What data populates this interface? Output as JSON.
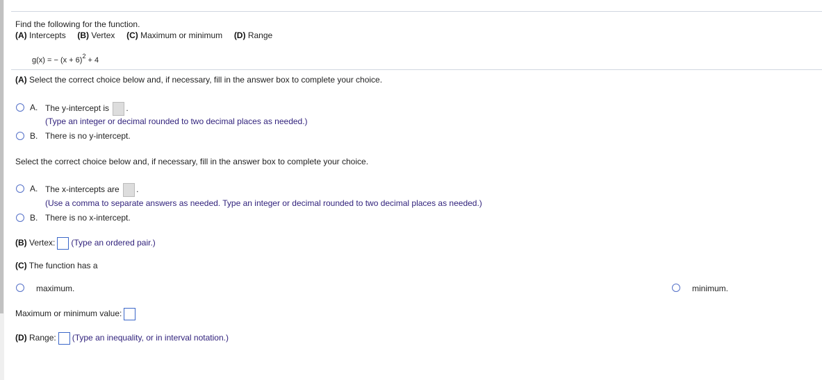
{
  "intro": "Find the following for the function.",
  "parts": {
    "a": "(A)",
    "a_label": "Intercepts",
    "b": "(B)",
    "b_label": "Vertex",
    "c": "(C)",
    "c_label": "Maximum or minimum",
    "d": "(D)",
    "d_label": "Range"
  },
  "function": {
    "lhs": "g(x) = − (x + 6)",
    "exp": "2",
    "rhs": "+ 4"
  },
  "partA": {
    "prefix": "(A)",
    "instruction": "Select the correct choice below and, if necessary, fill in the answer box to complete your choice.",
    "y": {
      "a_letter": "A.",
      "a_text": "The y-intercept is",
      "hint": "(Type an integer or decimal rounded to two decimal places as needed.)",
      "b_letter": "B.",
      "b_text": "There is no y-intercept."
    },
    "instruction2": "Select the correct choice below and, if necessary, fill in the answer box to complete your choice.",
    "x": {
      "a_letter": "A.",
      "a_text": "The x-intercepts are",
      "hint": "(Use a comma to separate answers as needed. Type an integer or decimal rounded to two decimal places as needed.)",
      "b_letter": "B.",
      "b_text": "There is no x-intercept."
    }
  },
  "partB": {
    "prefix": "(B)",
    "label": "Vertex:",
    "hint": "(Type an ordered pair.)"
  },
  "partC": {
    "prefix": "(C)",
    "label": "The function has a",
    "opt1": "maximum.",
    "opt2": "minimum.",
    "value_label": "Maximum or minimum value:"
  },
  "partD": {
    "prefix": "(D)",
    "label": "Range:",
    "hint": "(Type an inequality, or in interval notation.)"
  }
}
